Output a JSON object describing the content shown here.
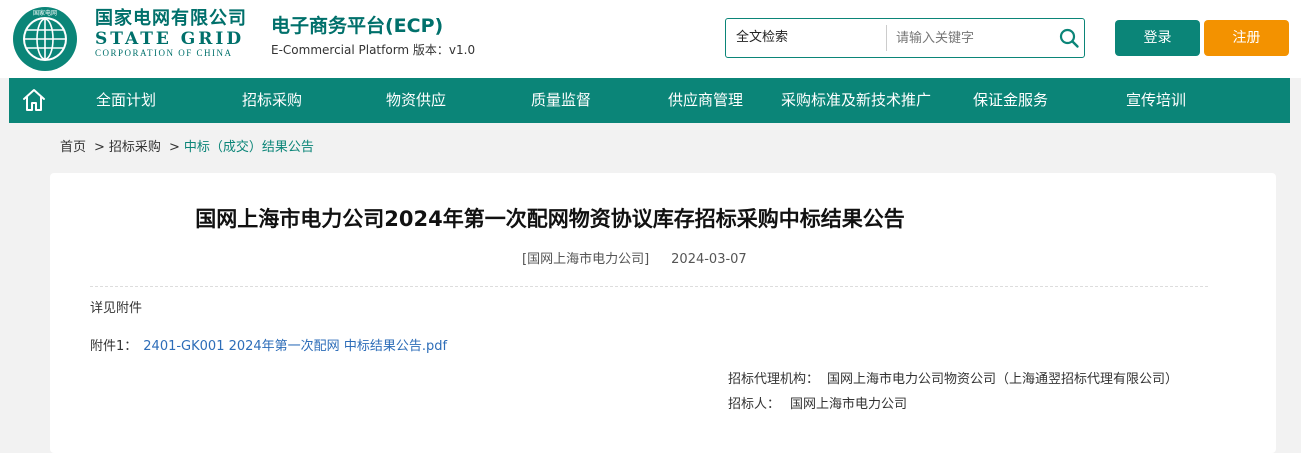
{
  "header": {
    "logo": {
      "cn": "国家电网有限公司",
      "en": "STATE GRID",
      "en_sub": "CORPORATION OF CHINA",
      "ring_text": "国家电网 STATE GRID CORPORATION OF CHINA"
    },
    "platform_name": "电子商务平台(ECP)",
    "platform_sub": "E-Commercial Platform 版本：v1.0",
    "search": {
      "scope": "全文检索",
      "placeholder": "请输入关键字",
      "icon": "search-icon"
    },
    "login_label": "登录",
    "register_label": "注册"
  },
  "nav": {
    "home_icon": "home-icon",
    "items": [
      {
        "label": "全面计划"
      },
      {
        "label": "招标采购"
      },
      {
        "label": "物资供应"
      },
      {
        "label": "质量监督"
      },
      {
        "label": "供应商管理"
      },
      {
        "label": "采购标准及新技术推广"
      },
      {
        "label": "保证金服务"
      },
      {
        "label": "宣传培训"
      }
    ]
  },
  "breadcrumb": {
    "items": [
      "首页",
      "招标采购",
      "中标（成交）结果公告"
    ],
    "separator": ">"
  },
  "article": {
    "title": "国网上海市电力公司2024年第一次配网物资协议库存招标采购中标结果公告",
    "source": "[国网上海市电力公司]",
    "date": "2024-03-07",
    "body": "详见附件",
    "attachment_label": "附件1：",
    "attachment_name": "2401-GK001 2024年第一次配网 中标结果公告.pdf",
    "agency_label": "招标代理机构：",
    "agency_value": "国网上海市电力公司物资公司（上海通翌招标代理有限公司）",
    "tenderer_label": "招标人：",
    "tenderer_value": "国网上海市电力公司"
  },
  "colors": {
    "brand_green": "#0b8578",
    "logo_green": "#00706b",
    "register_orange": "#f39200",
    "link_blue": "#2d6db8"
  }
}
